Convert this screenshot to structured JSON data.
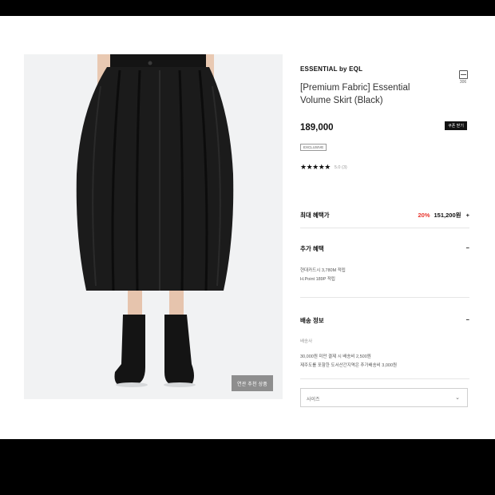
{
  "product": {
    "brand": "ESSENTIAL by EQL",
    "title": "[Premium Fabric] Essential Volume Skirt (Black)",
    "price": "189,000",
    "coupon_badge": "쿠폰 받기",
    "tag": "EXCLUSIVE",
    "stars": "★★★★★",
    "rating": "5.0 (3)",
    "share_count": "306",
    "image_button": "연관 추천 상품"
  },
  "benefits": {
    "max_label": "최대 혜택가",
    "discount": "20%",
    "max_price": "151,200원",
    "additional_label": "추가 혜택",
    "additional_lines": [
      "현대카드시 3,780M 적립",
      "H.Point 189P 적립"
    ]
  },
  "shipping": {
    "label": "배송 정보",
    "carrier": "배송사",
    "lines": [
      "30,000원 미만 결제 시 배송비 2,500원",
      "제주도를 포함한 도서산간지역은 추가배송비 3,000원"
    ]
  },
  "option": {
    "size_placeholder": "사이즈"
  },
  "icons": {
    "plus": "+",
    "minus": "−",
    "chevron": "⌄"
  },
  "colors": {
    "discount": "#e8332b",
    "badge_bg": "#111111"
  }
}
